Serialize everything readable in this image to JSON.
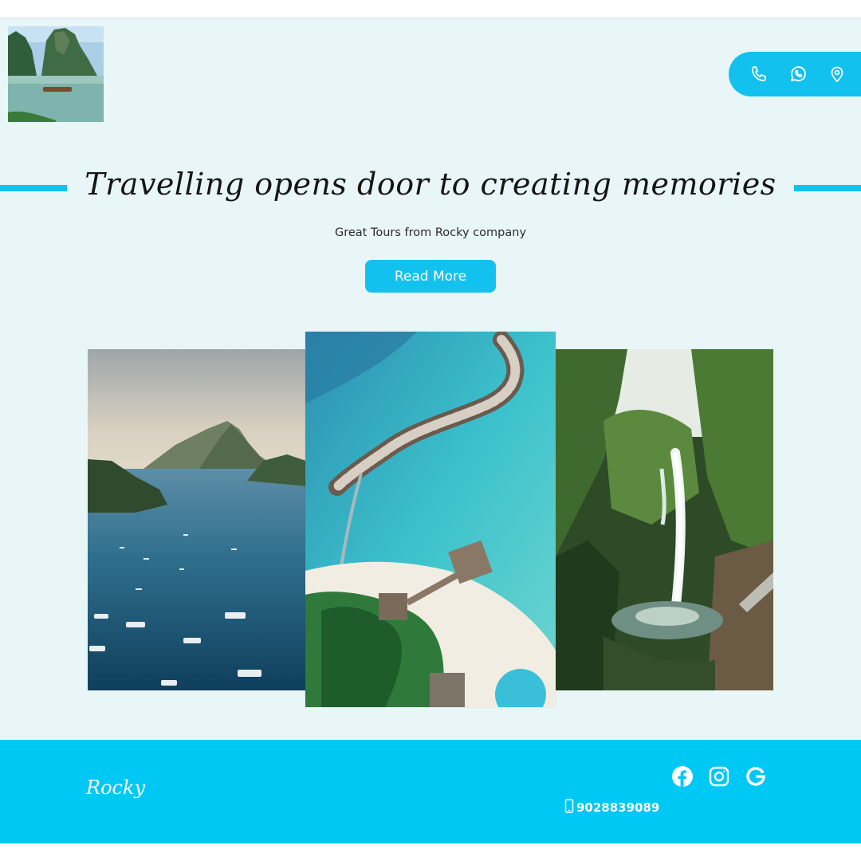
{
  "header": {
    "contact_icons": [
      "phone-icon",
      "whatsapp-icon",
      "location-pin-icon"
    ]
  },
  "hero": {
    "headline": "Travelling opens door to creating memories",
    "subtitle": "Great Tours from Rocky company",
    "cta_label": "Read More"
  },
  "gallery": {
    "photos": [
      "bay-islands-photo",
      "overwater-villas-photo",
      "jungle-waterfall-photo"
    ]
  },
  "footer": {
    "brand": "Rocky",
    "social_icons": [
      "facebook-icon",
      "instagram-icon",
      "google-icon"
    ],
    "phone": "9028839089"
  },
  "colors": {
    "accent": "#12c1ee",
    "footer_bg": "#00c8f5",
    "page_bg": "#e8f6f8"
  }
}
